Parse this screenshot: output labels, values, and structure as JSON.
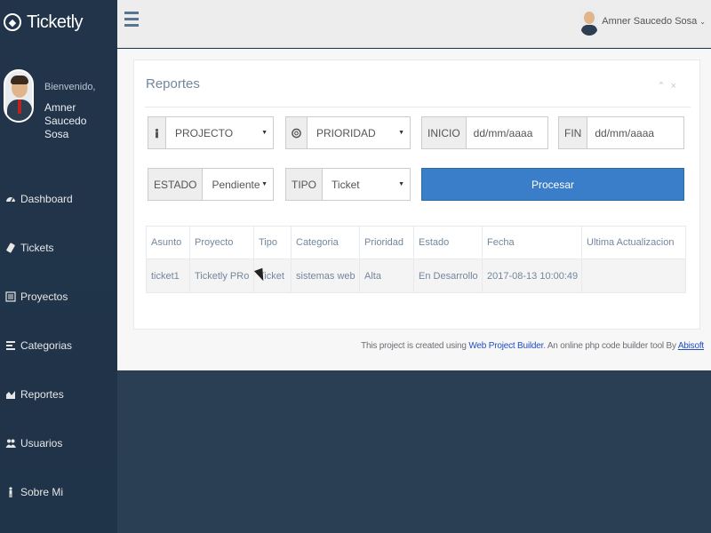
{
  "app": {
    "name": "Ticketly"
  },
  "sidebar": {
    "welcome": "Bienvenido,",
    "user_name": "Amner Saucedo Sosa",
    "items": [
      {
        "label": "Dashboard",
        "icon": "dashboard-icon"
      },
      {
        "label": "Tickets",
        "icon": "ticket-icon"
      },
      {
        "label": "Proyectos",
        "icon": "list-icon"
      },
      {
        "label": "Categorias",
        "icon": "align-list-icon"
      },
      {
        "label": "Reportes",
        "icon": "area-chart-icon"
      },
      {
        "label": "Usuarios",
        "icon": "users-icon"
      },
      {
        "label": "Sobre Mi",
        "icon": "person-icon"
      }
    ]
  },
  "topnav": {
    "user_name": "Amner Saucedo Sosa"
  },
  "panel": {
    "title": "Reportes",
    "filters": {
      "proyecto": "PROJECTO",
      "prioridad": "PRIORIDAD",
      "inicio_label": "INICIO",
      "inicio_placeholder": "dd/mm/aaaa",
      "fin_label": "FIN",
      "fin_placeholder": "dd/mm/aaaa",
      "estado_label": "ESTADO",
      "estado_value": "Pendiente",
      "tipo_label": "TIPO",
      "tipo_value": "Ticket"
    },
    "process_button": "Procesar",
    "table": {
      "headers": [
        "Asunto",
        "Proyecto",
        "Tipo",
        "Categoria",
        "Prioridad",
        "Estado",
        "Fecha",
        "Ultima Actualizacion"
      ],
      "rows": [
        [
          "ticket1",
          "Ticketly PRo",
          "Ticket",
          "sistemas web",
          "Alta",
          "En Desarrollo",
          "2017-08-13 10:00:49",
          ""
        ]
      ]
    }
  },
  "footer": {
    "prefix": "This project is created using",
    "link1": "Web Project Builder",
    "middle": ". An online php code builder tool By",
    "link2": "Abisoft"
  },
  "colors": {
    "sidebar_bg": "#22344a",
    "primary_button": "#3a7dc9",
    "link": "#1f4fbf"
  }
}
